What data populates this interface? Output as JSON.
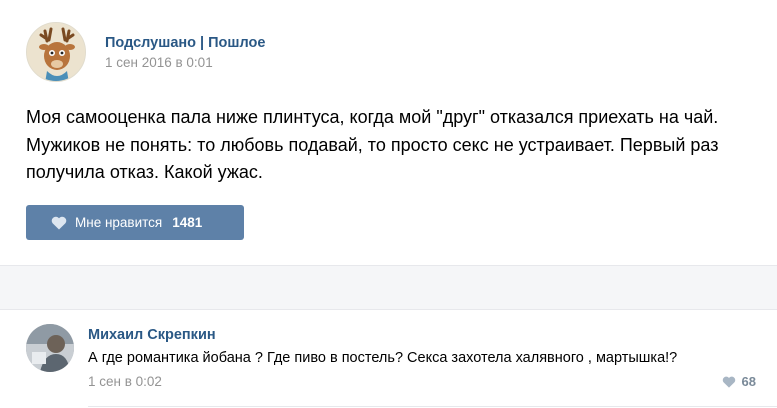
{
  "post": {
    "author": "Подслушано | Пошлое",
    "date": "1 сен 2016 в 0:01",
    "text": "Моя самооценка пала ниже плинтуса, когда мой \"друг\" отказался приехать на чай.\nМужиков не понять: то любовь подавай, то просто секс не устраивает. Первый раз\nполучила отказ. Какой ужас.",
    "like_label": "Мне нравится",
    "like_count": "1481"
  },
  "comment": {
    "author": "Михаил Скрепкин",
    "text": "А где романтика йобана ? Где пиво в постель? Секса захотела халявного , мартышка!?",
    "date": "1 сен в 0:02",
    "like_count": "68"
  },
  "colors": {
    "link": "#2a5885",
    "like_button": "#5e81a8",
    "muted": "#939393",
    "separator": "#f5f6f8"
  },
  "icons": {
    "post_avatar": "deer-avatar-icon",
    "like": "heart-icon"
  }
}
